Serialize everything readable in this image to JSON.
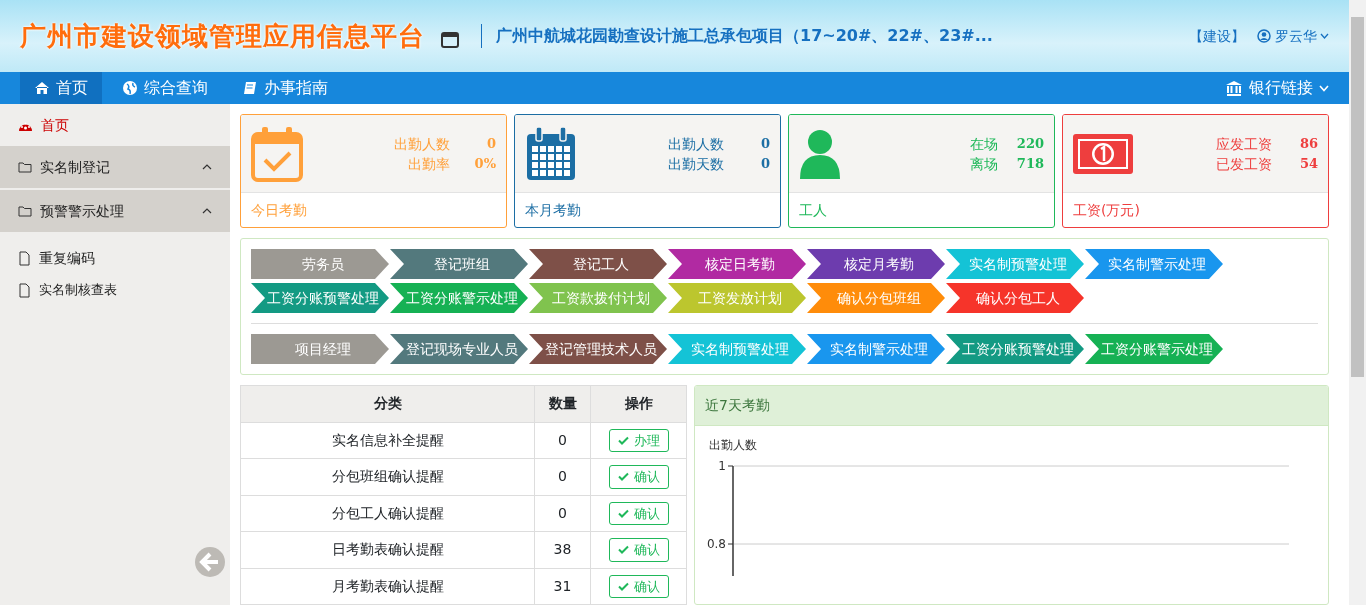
{
  "header": {
    "title": "广州市建设领域管理应用信息平台",
    "project": "广州中航城花园勘查设计施工总承包项目（17~20#、22#、23#...",
    "role": "【建设】",
    "user": "罗云华"
  },
  "nav": {
    "items": [
      {
        "label": "首页",
        "selected": true
      },
      {
        "label": "综合查询",
        "selected": false
      },
      {
        "label": "办事指南",
        "selected": false
      }
    ],
    "right": "银行链接"
  },
  "sidebar": {
    "items": [
      {
        "label": "首页",
        "kind": "link",
        "selected": true
      },
      {
        "label": "实名制登记",
        "kind": "group",
        "expanded": true
      },
      {
        "label": "预警警示处理",
        "kind": "group",
        "expanded": true,
        "children": [
          {
            "label": "重复编码",
            "selected": false
          },
          {
            "label": "实名制核查表",
            "selected": false
          }
        ]
      }
    ]
  },
  "stat_cards": [
    {
      "color": "#ffa03a",
      "title": "今日考勤",
      "stats": [
        {
          "label": "出勤人数",
          "value": "0"
        },
        {
          "label": "出勤率",
          "value": "0%"
        }
      ]
    },
    {
      "color": "#1c6ea4",
      "title": "本月考勤",
      "stats": [
        {
          "label": "出勤人数",
          "value": "0"
        },
        {
          "label": "出勤天数",
          "value": "0"
        }
      ]
    },
    {
      "color": "#1fb85a",
      "title": "工人",
      "stats": [
        {
          "label": "在场",
          "value": "220"
        },
        {
          "label": "离场",
          "value": "718"
        }
      ]
    },
    {
      "color": "#ee3e3e",
      "title": "工资(万元)",
      "stats": [
        {
          "label": "应发工资",
          "value": "86"
        },
        {
          "label": "已发工资",
          "value": "54"
        }
      ]
    }
  ],
  "flows": [
    {
      "steps": [
        {
          "label": "劳务员",
          "color": "#9c9993"
        },
        {
          "label": "登记班组",
          "color": "#53797d"
        },
        {
          "label": "登记工人",
          "color": "#7e5048"
        },
        {
          "label": "核定日考勤",
          "color": "#b12aa2"
        },
        {
          "label": "核定月考勤",
          "color": "#6d3cae"
        },
        {
          "label": "实名制预警处理",
          "color": "#14c3d6"
        },
        {
          "label": "实名制警示处理",
          "color": "#1996ee"
        },
        {
          "label": "工资分账预警处理",
          "color": "#139a83"
        },
        {
          "label": "工资分账警示处理",
          "color": "#16b154"
        },
        {
          "label": "工资款拨付计划",
          "color": "#80c34e"
        },
        {
          "label": "工资发放计划",
          "color": "#bcc62e"
        },
        {
          "label": "确认分包班组",
          "color": "#ff8c0a"
        },
        {
          "label": "确认分包工人",
          "color": "#f6342a"
        }
      ]
    },
    {
      "steps": [
        {
          "label": "项目经理",
          "color": "#9c9993"
        },
        {
          "label": "登记现场专业人员",
          "color": "#53797d"
        },
        {
          "label": "登记管理技术人员",
          "color": "#7e5048"
        },
        {
          "label": "实名制预警处理",
          "color": "#14c3d6"
        },
        {
          "label": "实名制警示处理",
          "color": "#1996ee"
        },
        {
          "label": "工资分账预警处理",
          "color": "#139a83"
        },
        {
          "label": "工资分账警示处理",
          "color": "#16b154"
        }
      ]
    }
  ],
  "table": {
    "columns": [
      "分类",
      "数量",
      "操作"
    ],
    "rows": [
      {
        "category": "实名信息补全提醒",
        "count": "0",
        "action": "办理"
      },
      {
        "category": "分包班组确认提醒",
        "count": "0",
        "action": "确认"
      },
      {
        "category": "分包工人确认提醒",
        "count": "0",
        "action": "确认"
      },
      {
        "category": "日考勤表确认提醒",
        "count": "38",
        "action": "确认"
      },
      {
        "category": "月考勤表确认提醒",
        "count": "31",
        "action": "确认"
      }
    ]
  },
  "attendance_panel": {
    "title": "近7天考勤",
    "axis_title": "出勤人数",
    "axis_ticks": [
      "1",
      "0.8"
    ]
  }
}
